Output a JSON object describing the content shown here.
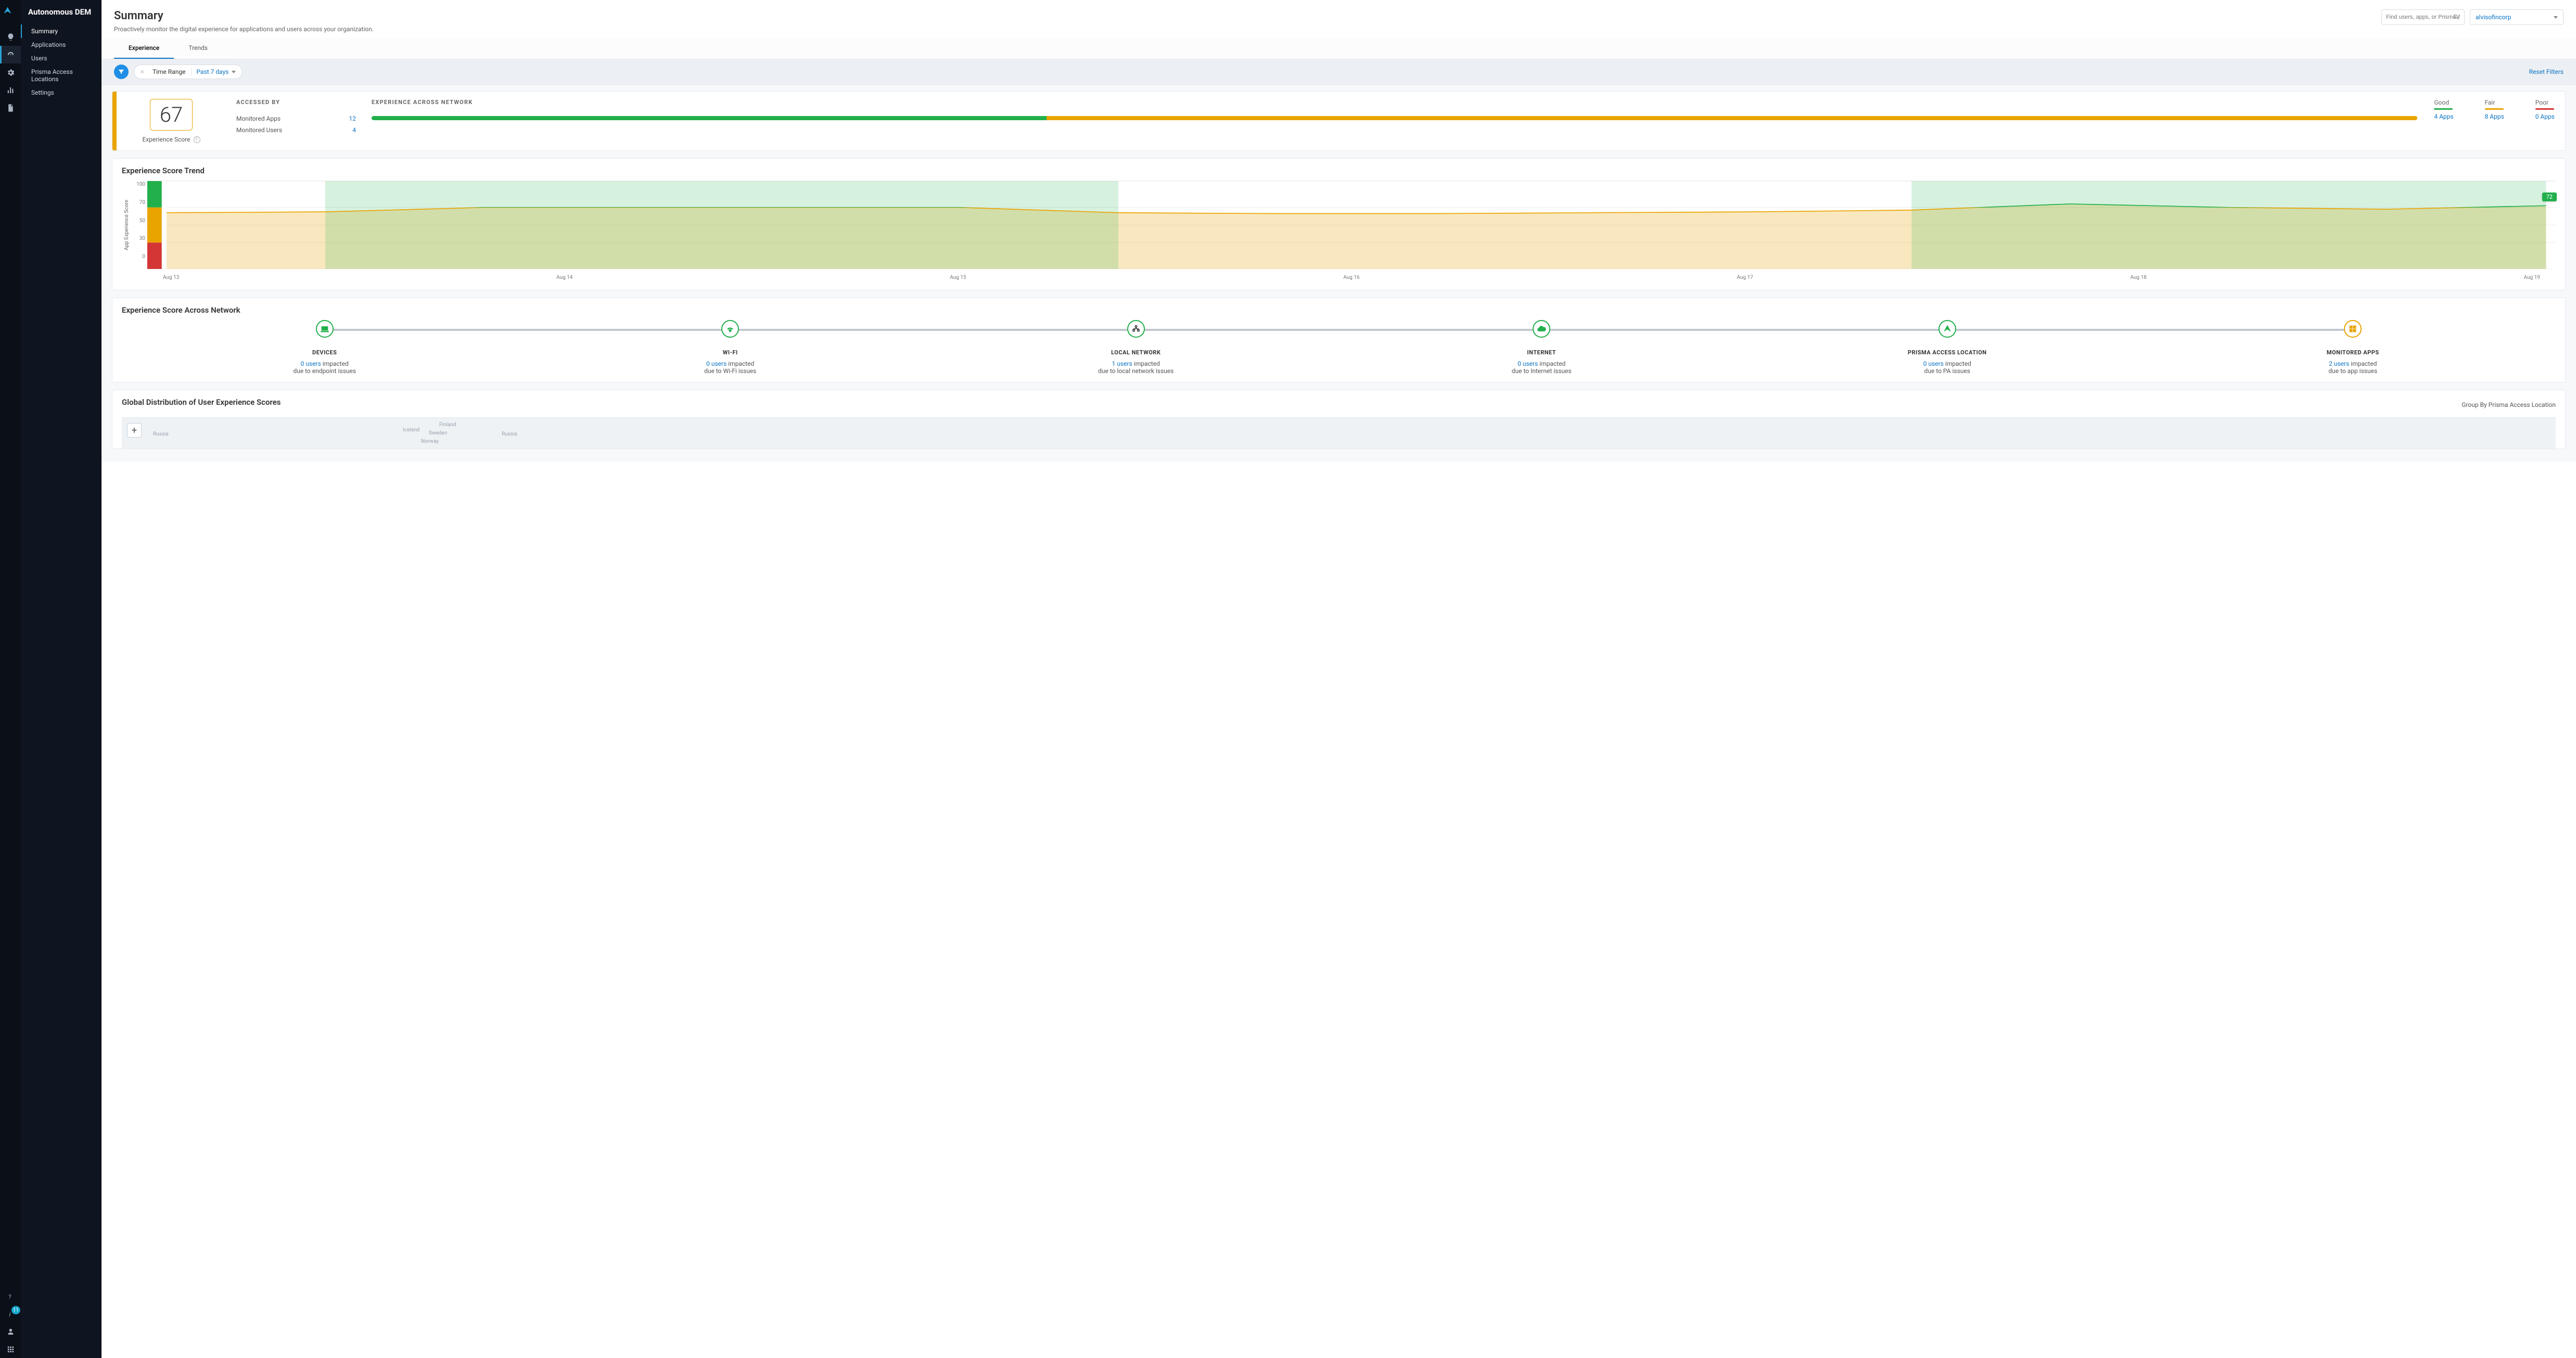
{
  "product_name": "Autonomous DEM",
  "rail_badge": "11",
  "nav": {
    "items": [
      "Summary",
      "Applications",
      "Users",
      "Prisma Access Locations",
      "Settings"
    ],
    "active": 0
  },
  "page": {
    "title": "Summary",
    "subtitle": "Proactively monitor the digital experience for applications and users across your organization."
  },
  "search": {
    "placeholder": "Find users, apps, or Prisma Access"
  },
  "tenant": {
    "value": "alvisofincorp"
  },
  "tabs": {
    "items": [
      "Experience",
      "Trends"
    ],
    "active": 0
  },
  "filters": {
    "time_label": "Time Range",
    "time_value": "Past 7 days",
    "reset": "Reset Filters"
  },
  "summary": {
    "score": "67",
    "score_label": "Experience Score",
    "accessed_label": "ACCESSED BY",
    "accessed": {
      "apps_label": "Monitored Apps",
      "apps_value": "12",
      "users_label": "Monitored Users",
      "users_value": "4"
    },
    "expnet_label": "EXPERIENCE ACROSS NETWORK",
    "bar": {
      "good_pct": 33,
      "fair_pct": 67,
      "poor_pct": 0
    },
    "legend": {
      "good_label": "Good",
      "good_link": "4 Apps",
      "fair_label": "Fair",
      "fair_link": "8 Apps",
      "poor_label": "Poor",
      "poor_link": "0 Apps"
    }
  },
  "trend": {
    "title": "Experience Score Trend",
    "ylabel": "App Experience Score",
    "end_value": "72"
  },
  "segments_card": {
    "title": "Experience Score Across Network",
    "nodes": [
      {
        "key": "devices",
        "title": "DEVICES",
        "users": "0 users",
        "txt1": "impacted",
        "txt2": "due to endpoint issues",
        "color": "green",
        "icon": "laptop"
      },
      {
        "key": "wifi",
        "title": "Wi-Fi",
        "users": "0 users",
        "txt1": "impacted",
        "txt2": "due to Wi-Fi issues",
        "color": "green",
        "icon": "wifi"
      },
      {
        "key": "lan",
        "title": "LOCAL NETWORK",
        "users": "1 users",
        "txt1": "impacted",
        "txt2": "due to local network issues",
        "color": "green",
        "icon": "network"
      },
      {
        "key": "internet",
        "title": "INTERNET",
        "users": "0 users",
        "txt1": "impacted",
        "txt2": "due to Internet issues",
        "color": "green",
        "icon": "cloud"
      },
      {
        "key": "pa",
        "title": "PRISMA ACCESS LOCATION",
        "users": "0 users",
        "txt1": "impacted",
        "txt2": "due to PA issues",
        "color": "green",
        "icon": "prisma"
      },
      {
        "key": "apps",
        "title": "MONITORED APPS",
        "users": "2 users",
        "txt1": "impacted",
        "txt2": "due to app issues",
        "color": "orange",
        "icon": "app"
      }
    ]
  },
  "map": {
    "title": "Global Distribution of User Experience Scores",
    "groupby": "Group By Prisma Access Location",
    "labels": [
      "Russia",
      "Iceland",
      "Finland",
      "Sweden",
      "Norway",
      "Russia"
    ]
  },
  "chart_data": {
    "type": "area",
    "title": "Experience Score Trend",
    "ylabel": "App Experience Score",
    "ylim": [
      0,
      100
    ],
    "yticks": [
      0,
      30,
      50,
      70,
      100
    ],
    "threshold_colors": {
      "poor": "#d43535",
      "fair": "#e9a400",
      "good": "#21b04b",
      "poor_max": 30,
      "fair_max": 70
    },
    "x_categories": [
      "Aug 13",
      "Aug 14",
      "Aug 15",
      "Aug 16",
      "Aug 17",
      "Aug 18",
      "Aug 19"
    ],
    "series": [
      {
        "name": "App Experience Score",
        "x": [
          "Aug 12 12:00",
          "Aug 13",
          "Aug 13 12:00",
          "Aug 14",
          "Aug 14 12:00",
          "Aug 15",
          "Aug 15 06:00",
          "Aug 15 12:00",
          "Aug 16",
          "Aug 16 12:00",
          "Aug 17",
          "Aug 17 12:00",
          "Aug 18",
          "Aug 18 06:00",
          "Aug 18 12:00",
          "Aug 19"
        ],
        "values": [
          64,
          65,
          70,
          70,
          70,
          70,
          64,
          63,
          63,
          64,
          65,
          67,
          74,
          70,
          68,
          72
        ]
      }
    ],
    "end_label": 72
  }
}
